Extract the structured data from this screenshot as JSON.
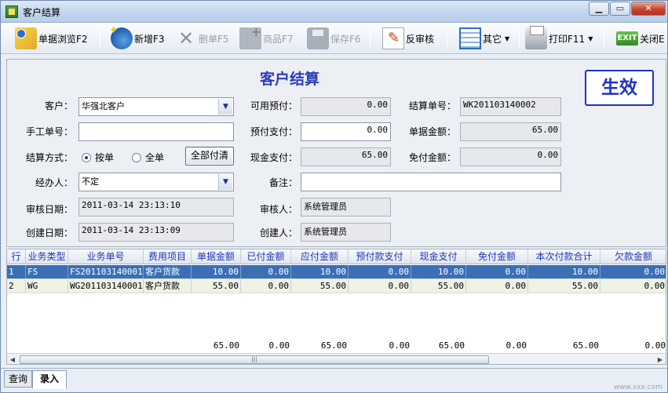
{
  "window": {
    "title": "客户结算"
  },
  "toolbar": {
    "browse": "单据浏览F2",
    "new": "新增F3",
    "delete": "删单F5",
    "goods": "商品F7",
    "save": "保存F6",
    "unaudit": "反审核",
    "other": "其它",
    "print": "打印F11",
    "close": "关闭E",
    "exit_icon_text": "EXIT"
  },
  "form": {
    "title": "客户结算",
    "status": "生效",
    "customer_label": "客户：",
    "customer_value": "华强北客户",
    "manual_no_label": "手工单号：",
    "manual_no_value": "",
    "settle_mode_label": "结算方式：",
    "mode_by_bill": "按单",
    "mode_all": "全单",
    "pay_all_button": "全部付清",
    "handler_label": "经办人：",
    "handler_value": "不定",
    "audit_date_label": "审核日期：",
    "audit_date_value": "2011-03-14 23:13:10",
    "create_date_label": "创建日期：",
    "create_date_value": "2011-03-14 23:13:09",
    "avail_prepay_label": "可用预付：",
    "avail_prepay_value": "0.00",
    "prepay_pay_label": "预付支付：",
    "prepay_pay_value": "0.00",
    "cash_pay_label": "现金支付：",
    "cash_pay_value": "65.00",
    "remark_label": "备注：",
    "remark_value": "",
    "auditor_label": "审核人：",
    "auditor_value": "系统管理员",
    "creator_label": "创建人：",
    "creator_value": "系统管理员",
    "settle_no_label": "结算单号：",
    "settle_no_value": "WK201103140002",
    "bill_amount_label": "单据金额：",
    "bill_amount_value": "65.00",
    "waive_amount_label": "免付金额：",
    "waive_amount_value": "0.00"
  },
  "grid": {
    "headers": [
      "行",
      "业务类型",
      "业务单号",
      "费用项目",
      "单据金额",
      "已付金额",
      "应付金额",
      "预付款支付",
      "现金支付",
      "免付金额",
      "本次付款合计",
      "欠款金额"
    ],
    "rows": [
      [
        "1",
        "FS",
        "FS201103140001",
        "客户货款",
        "10.00",
        "0.00",
        "10.00",
        "0.00",
        "10.00",
        "0.00",
        "10.00",
        "0.00"
      ],
      [
        "2",
        "WG",
        "WG201103140001",
        "客户货款",
        "55.00",
        "0.00",
        "55.00",
        "0.00",
        "55.00",
        "0.00",
        "55.00",
        "0.00"
      ]
    ],
    "totals": [
      "65.00",
      "0.00",
      "65.00",
      "0.00",
      "65.00",
      "0.00",
      "65.00",
      "0.00"
    ]
  },
  "tabs": [
    "查询",
    "录入"
  ],
  "watermark": "www.xxx.com"
}
